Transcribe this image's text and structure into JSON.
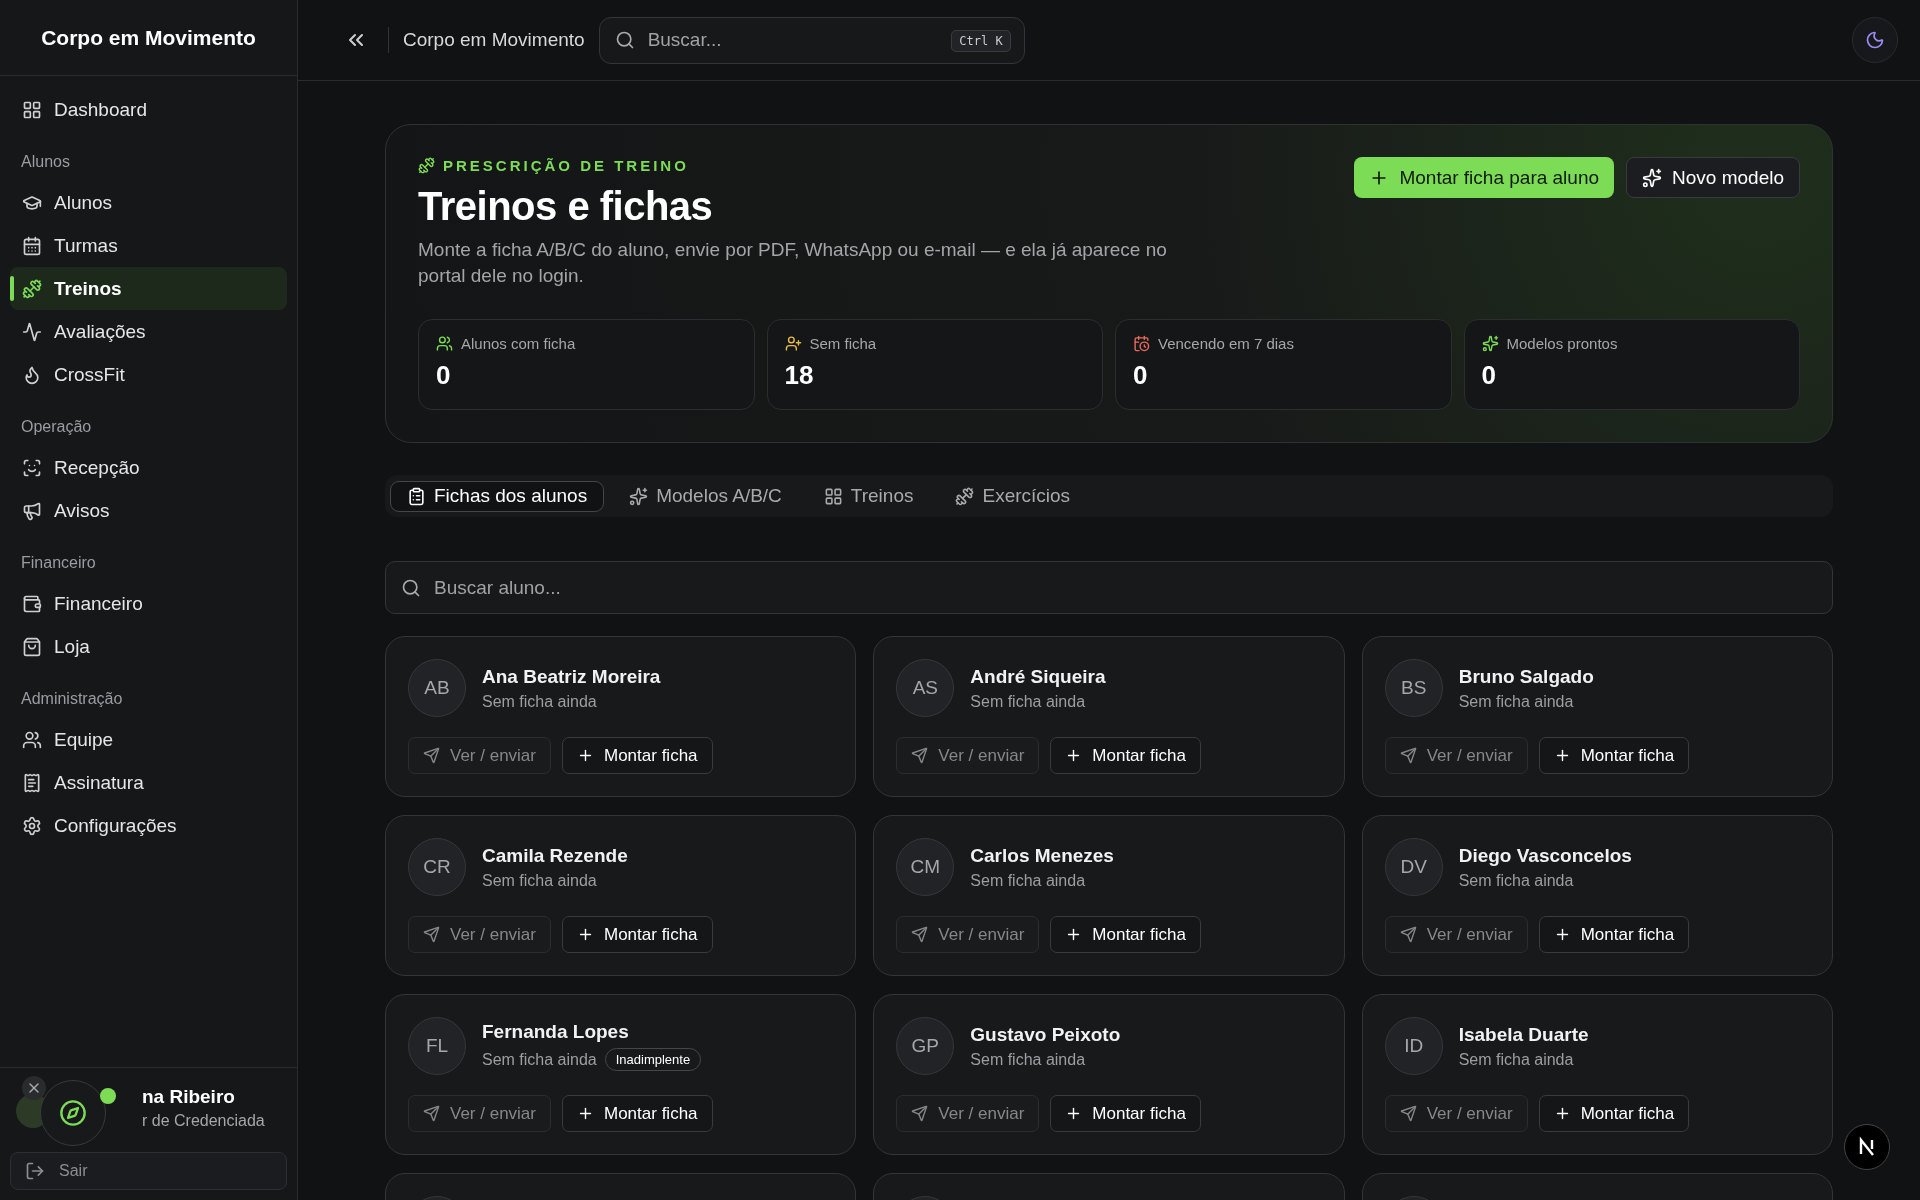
{
  "sidebar": {
    "brand": "Corpo em Movimento",
    "sections": [
      {
        "items": [
          {
            "label": "Dashboard",
            "selected": false
          }
        ]
      },
      {
        "title": "Alunos",
        "items": [
          {
            "label": "Alunos",
            "selected": false
          },
          {
            "label": "Turmas",
            "selected": false
          },
          {
            "label": "Treinos",
            "selected": true
          },
          {
            "label": "Avaliações",
            "selected": false
          },
          {
            "label": "CrossFit",
            "selected": false
          }
        ]
      },
      {
        "title": "Operação",
        "items": [
          {
            "label": "Recepção",
            "selected": false
          },
          {
            "label": "Avisos",
            "selected": false
          }
        ]
      },
      {
        "title": "Financeiro",
        "items": [
          {
            "label": "Financeiro",
            "selected": false
          },
          {
            "label": "Loja",
            "selected": false
          }
        ]
      },
      {
        "title": "Administração",
        "items": [
          {
            "label": "Equipe",
            "selected": false
          },
          {
            "label": "Assinatura",
            "selected": false
          },
          {
            "label": "Configurações",
            "selected": false
          }
        ]
      }
    ],
    "user": {
      "name": "na Ribeiro",
      "role": "r de Credenciada"
    },
    "logout": "Sair"
  },
  "header": {
    "breadcrumb": "Corpo em Movimento",
    "search": {
      "placeholder": "Buscar...",
      "shortcut": "Ctrl K"
    }
  },
  "hero": {
    "eyebrow": "PRESCRIÇÃO DE TREINO",
    "title": "Treinos e fichas",
    "description": "Monte a ficha A/B/C do aluno, envie por PDF, WhatsApp ou e-mail — e ela já aparece no portal dele no login.",
    "actions": [
      {
        "label": "Montar ficha para aluno",
        "kind": "primary"
      },
      {
        "label": "Novo modelo",
        "kind": "secondary"
      }
    ],
    "stats": [
      {
        "label": "Alunos com ficha",
        "value": "0"
      },
      {
        "label": "Sem ficha",
        "value": "18"
      },
      {
        "label": "Vencendo em 7 dias",
        "value": "0"
      },
      {
        "label": "Modelos prontos",
        "value": "0"
      }
    ]
  },
  "tabs": [
    {
      "label": "Fichas dos alunos",
      "selected": true
    },
    {
      "label": "Modelos A/B/C",
      "selected": false
    },
    {
      "label": "Treinos",
      "selected": false
    },
    {
      "label": "Exercícios",
      "selected": false
    }
  ],
  "student_search": {
    "placeholder": "Buscar aluno..."
  },
  "students": [
    {
      "kind": "full",
      "initials": "AB",
      "name": "Ana Beatriz Moreira",
      "status": "Sem ficha ainda",
      "view": "Ver / enviar",
      "build": "Montar ficha"
    },
    {
      "kind": "full",
      "initials": "AS",
      "name": "André Siqueira",
      "status": "Sem ficha ainda",
      "view": "Ver / enviar",
      "build": "Montar ficha"
    },
    {
      "kind": "full",
      "initials": "BS",
      "name": "Bruno Salgado",
      "status": "Sem ficha ainda",
      "view": "Ver / enviar",
      "build": "Montar ficha"
    },
    {
      "kind": "full",
      "initials": "CR",
      "name": "Camila Rezende",
      "status": "Sem ficha ainda",
      "view": "Ver / enviar",
      "build": "Montar ficha"
    },
    {
      "kind": "full",
      "initials": "CM",
      "name": "Carlos Menezes",
      "status": "Sem ficha ainda",
      "view": "Ver / enviar",
      "build": "Montar ficha"
    },
    {
      "kind": "full",
      "initials": "DV",
      "name": "Diego Vasconcelos",
      "status": "Sem ficha ainda",
      "view": "Ver / enviar",
      "build": "Montar ficha"
    },
    {
      "kind": "full",
      "initials": "FL",
      "name": "Fernanda Lopes",
      "status": "Sem ficha ainda",
      "badge": "Inadimplente",
      "view": "Ver / enviar",
      "build": "Montar ficha"
    },
    {
      "kind": "full",
      "initials": "GP",
      "name": "Gustavo Peixoto",
      "status": "Sem ficha ainda",
      "view": "Ver / enviar",
      "build": "Montar ficha"
    },
    {
      "kind": "full",
      "initials": "ID",
      "name": "Isabela Duarte",
      "status": "Sem ficha ainda",
      "view": "Ver / enviar",
      "build": "Montar ficha"
    },
    {
      "kind": "cut"
    },
    {
      "kind": "cut"
    },
    {
      "kind": "cut"
    }
  ]
}
